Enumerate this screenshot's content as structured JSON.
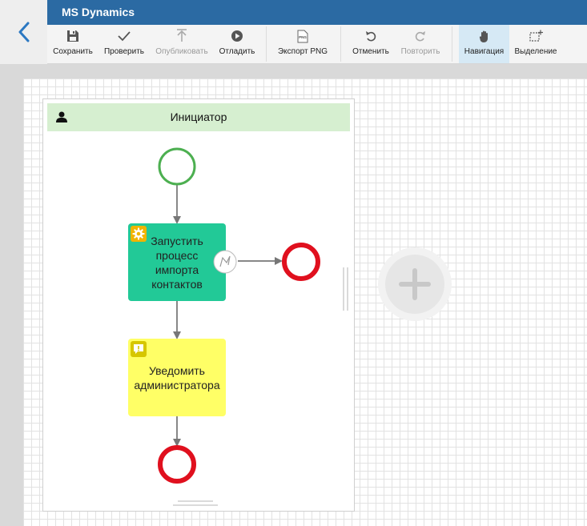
{
  "window": {
    "title": "MS Dynamics"
  },
  "toolbar": {
    "save": "Сохранить",
    "check": "Проверить",
    "publish": "Опубликовать",
    "debug": "Отладить",
    "export_png": "Экспорт PNG",
    "export_icon_text": "PNG",
    "undo": "Отменить",
    "redo": "Повторить",
    "navigation": "Навигация",
    "selection": "Выделение"
  },
  "lane": {
    "title": "Инициатор"
  },
  "tasks": {
    "import": {
      "line1": "Запустить",
      "line2": "процесс",
      "line3": "импорта",
      "line4": "контактов",
      "color": "#22c997"
    },
    "notify": {
      "line1": "Уведомить",
      "line2": "администратора",
      "color": "#ffff66"
    }
  },
  "colors": {
    "start_event": "#4caf50",
    "end_event": "#e0101e",
    "accent": "#2b6aa3"
  },
  "icons": [
    "back-arrow-icon",
    "save-icon",
    "check-icon",
    "publish-icon",
    "debug-icon",
    "png-file-icon",
    "undo-icon",
    "redo-icon",
    "hand-icon",
    "selection-icon",
    "user-icon",
    "gear-icon",
    "message-icon",
    "error-boundary-icon",
    "plus-icon"
  ]
}
